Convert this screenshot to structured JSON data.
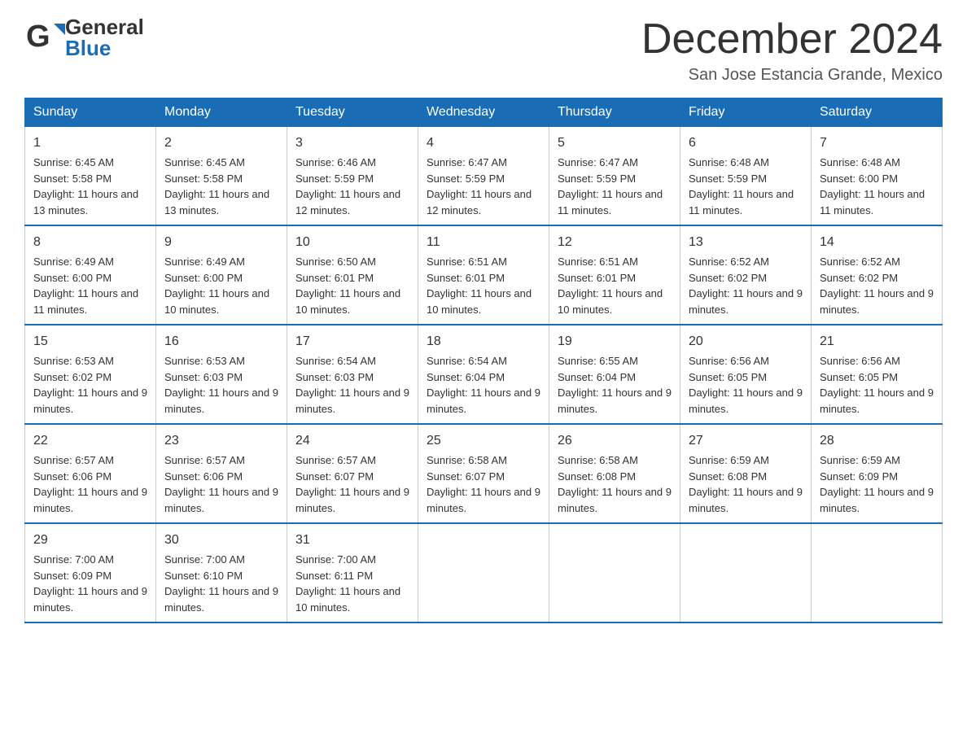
{
  "header": {
    "logo": {
      "text_general": "General",
      "text_blue": "Blue",
      "alt": "GeneralBlue logo"
    },
    "title": "December 2024",
    "subtitle": "San Jose Estancia Grande, Mexico"
  },
  "weekdays": [
    "Sunday",
    "Monday",
    "Tuesday",
    "Wednesday",
    "Thursday",
    "Friday",
    "Saturday"
  ],
  "weeks": [
    [
      {
        "day": "1",
        "sunrise": "6:45 AM",
        "sunset": "5:58 PM",
        "daylight": "11 hours and 13 minutes."
      },
      {
        "day": "2",
        "sunrise": "6:45 AM",
        "sunset": "5:58 PM",
        "daylight": "11 hours and 13 minutes."
      },
      {
        "day": "3",
        "sunrise": "6:46 AM",
        "sunset": "5:59 PM",
        "daylight": "11 hours and 12 minutes."
      },
      {
        "day": "4",
        "sunrise": "6:47 AM",
        "sunset": "5:59 PM",
        "daylight": "11 hours and 12 minutes."
      },
      {
        "day": "5",
        "sunrise": "6:47 AM",
        "sunset": "5:59 PM",
        "daylight": "11 hours and 11 minutes."
      },
      {
        "day": "6",
        "sunrise": "6:48 AM",
        "sunset": "5:59 PM",
        "daylight": "11 hours and 11 minutes."
      },
      {
        "day": "7",
        "sunrise": "6:48 AM",
        "sunset": "6:00 PM",
        "daylight": "11 hours and 11 minutes."
      }
    ],
    [
      {
        "day": "8",
        "sunrise": "6:49 AM",
        "sunset": "6:00 PM",
        "daylight": "11 hours and 11 minutes."
      },
      {
        "day": "9",
        "sunrise": "6:49 AM",
        "sunset": "6:00 PM",
        "daylight": "11 hours and 10 minutes."
      },
      {
        "day": "10",
        "sunrise": "6:50 AM",
        "sunset": "6:01 PM",
        "daylight": "11 hours and 10 minutes."
      },
      {
        "day": "11",
        "sunrise": "6:51 AM",
        "sunset": "6:01 PM",
        "daylight": "11 hours and 10 minutes."
      },
      {
        "day": "12",
        "sunrise": "6:51 AM",
        "sunset": "6:01 PM",
        "daylight": "11 hours and 10 minutes."
      },
      {
        "day": "13",
        "sunrise": "6:52 AM",
        "sunset": "6:02 PM",
        "daylight": "11 hours and 9 minutes."
      },
      {
        "day": "14",
        "sunrise": "6:52 AM",
        "sunset": "6:02 PM",
        "daylight": "11 hours and 9 minutes."
      }
    ],
    [
      {
        "day": "15",
        "sunrise": "6:53 AM",
        "sunset": "6:02 PM",
        "daylight": "11 hours and 9 minutes."
      },
      {
        "day": "16",
        "sunrise": "6:53 AM",
        "sunset": "6:03 PM",
        "daylight": "11 hours and 9 minutes."
      },
      {
        "day": "17",
        "sunrise": "6:54 AM",
        "sunset": "6:03 PM",
        "daylight": "11 hours and 9 minutes."
      },
      {
        "day": "18",
        "sunrise": "6:54 AM",
        "sunset": "6:04 PM",
        "daylight": "11 hours and 9 minutes."
      },
      {
        "day": "19",
        "sunrise": "6:55 AM",
        "sunset": "6:04 PM",
        "daylight": "11 hours and 9 minutes."
      },
      {
        "day": "20",
        "sunrise": "6:56 AM",
        "sunset": "6:05 PM",
        "daylight": "11 hours and 9 minutes."
      },
      {
        "day": "21",
        "sunrise": "6:56 AM",
        "sunset": "6:05 PM",
        "daylight": "11 hours and 9 minutes."
      }
    ],
    [
      {
        "day": "22",
        "sunrise": "6:57 AM",
        "sunset": "6:06 PM",
        "daylight": "11 hours and 9 minutes."
      },
      {
        "day": "23",
        "sunrise": "6:57 AM",
        "sunset": "6:06 PM",
        "daylight": "11 hours and 9 minutes."
      },
      {
        "day": "24",
        "sunrise": "6:57 AM",
        "sunset": "6:07 PM",
        "daylight": "11 hours and 9 minutes."
      },
      {
        "day": "25",
        "sunrise": "6:58 AM",
        "sunset": "6:07 PM",
        "daylight": "11 hours and 9 minutes."
      },
      {
        "day": "26",
        "sunrise": "6:58 AM",
        "sunset": "6:08 PM",
        "daylight": "11 hours and 9 minutes."
      },
      {
        "day": "27",
        "sunrise": "6:59 AM",
        "sunset": "6:08 PM",
        "daylight": "11 hours and 9 minutes."
      },
      {
        "day": "28",
        "sunrise": "6:59 AM",
        "sunset": "6:09 PM",
        "daylight": "11 hours and 9 minutes."
      }
    ],
    [
      {
        "day": "29",
        "sunrise": "7:00 AM",
        "sunset": "6:09 PM",
        "daylight": "11 hours and 9 minutes."
      },
      {
        "day": "30",
        "sunrise": "7:00 AM",
        "sunset": "6:10 PM",
        "daylight": "11 hours and 9 minutes."
      },
      {
        "day": "31",
        "sunrise": "7:00 AM",
        "sunset": "6:11 PM",
        "daylight": "11 hours and 10 minutes."
      },
      null,
      null,
      null,
      null
    ]
  ]
}
